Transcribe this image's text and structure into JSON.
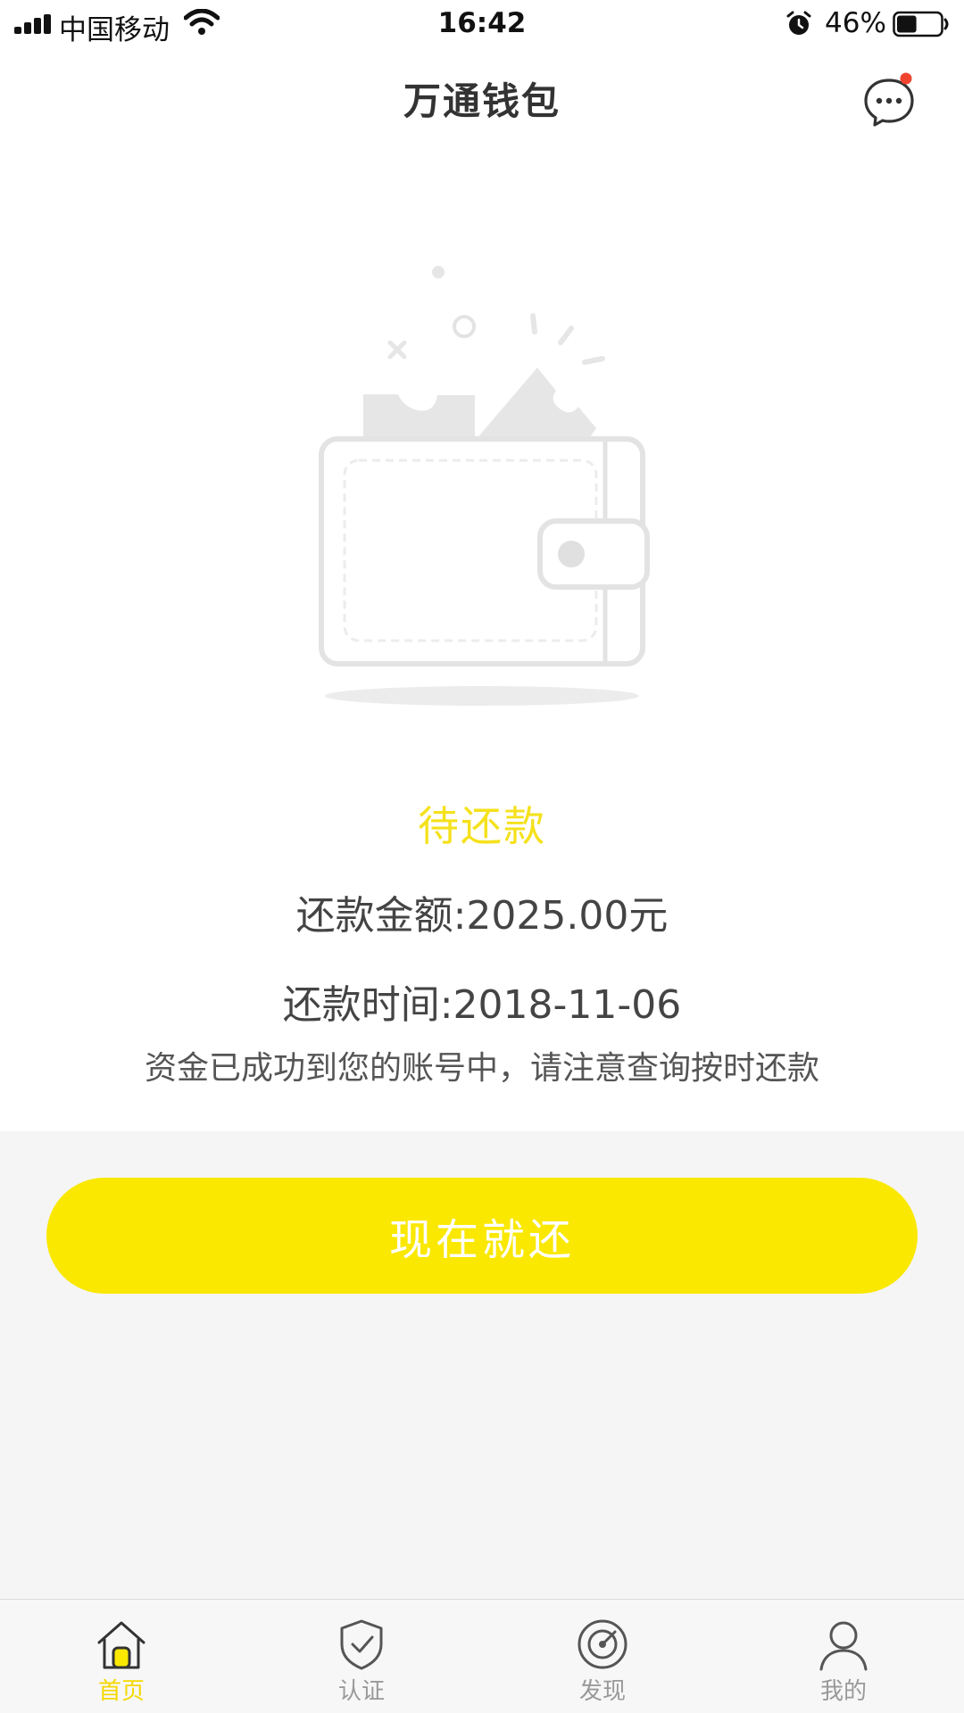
{
  "status_bar": {
    "carrier": "中国移动",
    "time": "16:42",
    "battery_percent": "46%",
    "battery_level": 0.46
  },
  "nav": {
    "title": "万通钱包",
    "has_notification_dot": true
  },
  "main": {
    "status_title": "待还款",
    "amount_line": "还款金额:2025.00元",
    "time_line": "还款时间:2018-11-06",
    "notice": "资金已成功到您的账号中，请注意查询按时还款",
    "repay_button": "现在就还"
  },
  "tabs": [
    {
      "label": "首页",
      "icon": "home-icon",
      "active": true
    },
    {
      "label": "认证",
      "icon": "shield-check-icon",
      "active": false
    },
    {
      "label": "发现",
      "icon": "compass-icon",
      "active": false
    },
    {
      "label": "我的",
      "icon": "user-icon",
      "active": false
    }
  ],
  "colors": {
    "accent_yellow": "#fae800",
    "status_yellow": "#f5e11c",
    "notification_red": "#f0442e",
    "inactive_gray": "#999999"
  }
}
